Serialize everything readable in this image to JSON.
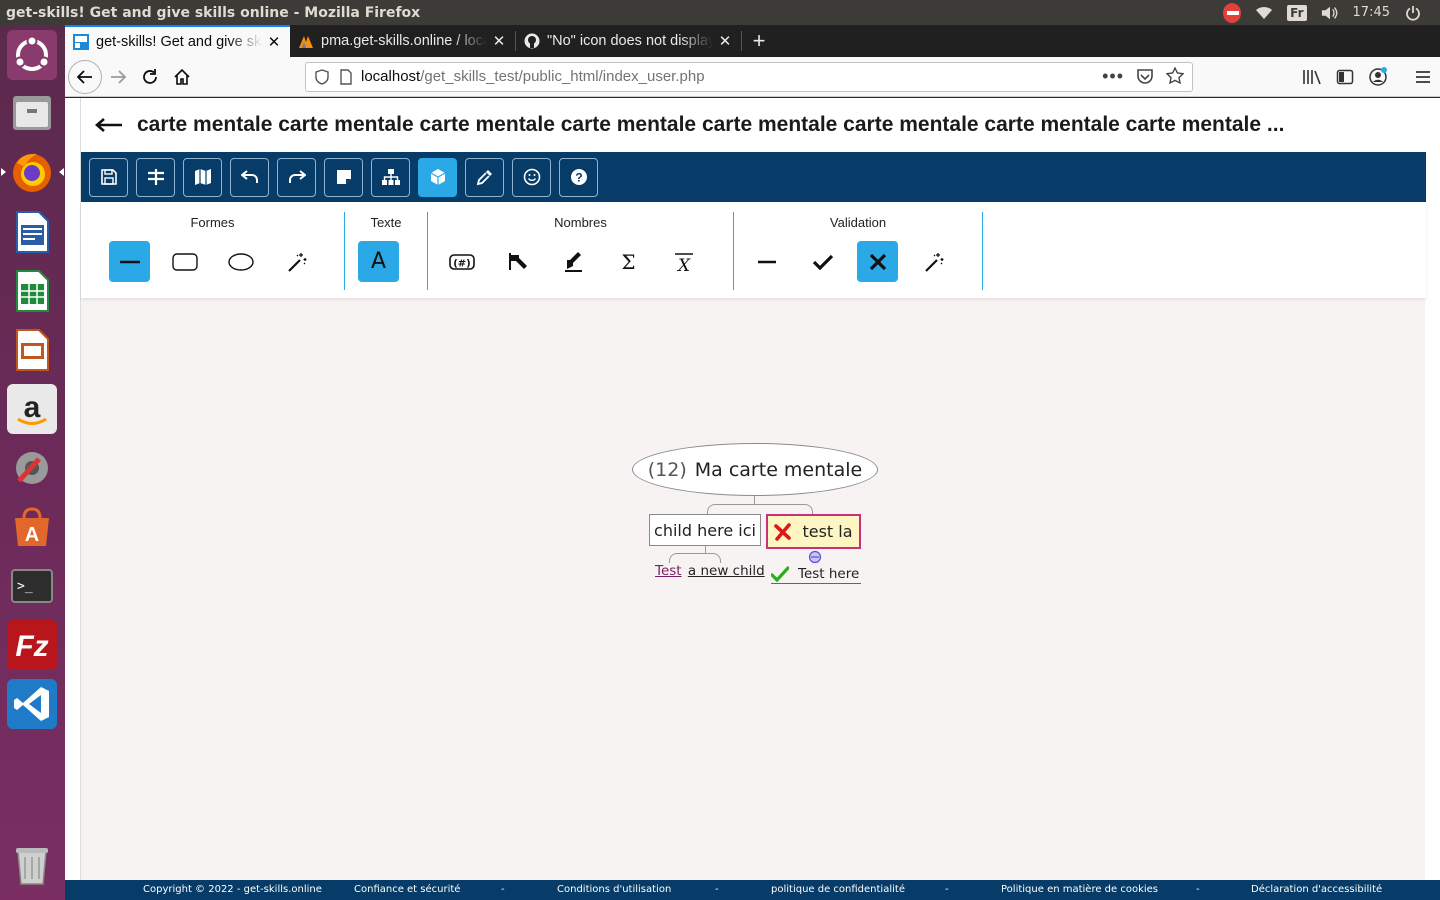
{
  "os": {
    "window_title": "get-skills! Get and give skills online - Mozilla Firefox",
    "keyboard_layout": "Fr",
    "clock": "17:45"
  },
  "launcher": {
    "items": [
      "ubuntu-dash",
      "file-manager",
      "firefox",
      "libreoffice-writer",
      "libreoffice-calc",
      "libreoffice-impress",
      "amazon",
      "system-settings",
      "software-center",
      "terminal",
      "filezilla",
      "vscode",
      "trash"
    ]
  },
  "browser": {
    "tabs": [
      {
        "label": "get-skills! Get and give skills online",
        "active": true
      },
      {
        "label": "pma.get-skills.online / localhost",
        "active": false
      },
      {
        "label": "\"No\" icon does not display",
        "active": false
      }
    ],
    "url_host": "localhost",
    "url_path": "/get_skills_test/public_html/index_user.php"
  },
  "page": {
    "map_title": "carte mentale carte mentale carte mentale carte mentale carte mentale carte mentale carte mentale carte mentale ...",
    "toolbar": [
      "save-icon",
      "format-icon",
      "map-icon",
      "undo-icon",
      "redo-icon",
      "note-icon",
      "hierarchy-icon",
      "cube-icon",
      "eyedropper-icon",
      "smiley-icon",
      "help-icon"
    ],
    "palette": {
      "groups": [
        {
          "label": "Formes",
          "tools": [
            "line-shape",
            "rounded-rect-shape",
            "ellipse-shape",
            "magic-wand"
          ]
        },
        {
          "label": "Texte",
          "tools": [
            "text-a"
          ]
        },
        {
          "label": "Nombres",
          "tools": [
            "number-tag",
            "arrow-up-left",
            "arrow-down-left",
            "sigma",
            "x-bar"
          ]
        },
        {
          "label": "Validation",
          "tools": [
            "dash",
            "checkmark",
            "cross",
            "magic-wand"
          ]
        }
      ],
      "text_tool_glyph": "A",
      "sigma_glyph": "Σ",
      "number_glyph": "(#)"
    },
    "mindmap": {
      "root": {
        "count": "(12)",
        "label": "Ma carte mentale"
      },
      "children": [
        {
          "label": "child here ici",
          "leaf": {
            "prefix": "Test",
            "label": "a new child"
          }
        },
        {
          "label": "test la",
          "status": "invalid",
          "leaf": {
            "label": "Test here",
            "status": "valid"
          }
        }
      ]
    },
    "footer": {
      "copyright": "Copyright © 2022 - get-skills.online",
      "links": [
        "Confiance et sécurité",
        "Conditions d'utilisation",
        "politique de confidentialité",
        "Politique en matière de cookies",
        "Déclaration d'accessibilité"
      ],
      "separator": "-"
    }
  },
  "colors": {
    "toolbar_bg": "#063c67",
    "accent": "#2ba9e7",
    "invalid": "#e0161b",
    "valid": "#22b01b",
    "child_border": "#c8307a",
    "child_bg": "#fdf6c3"
  }
}
